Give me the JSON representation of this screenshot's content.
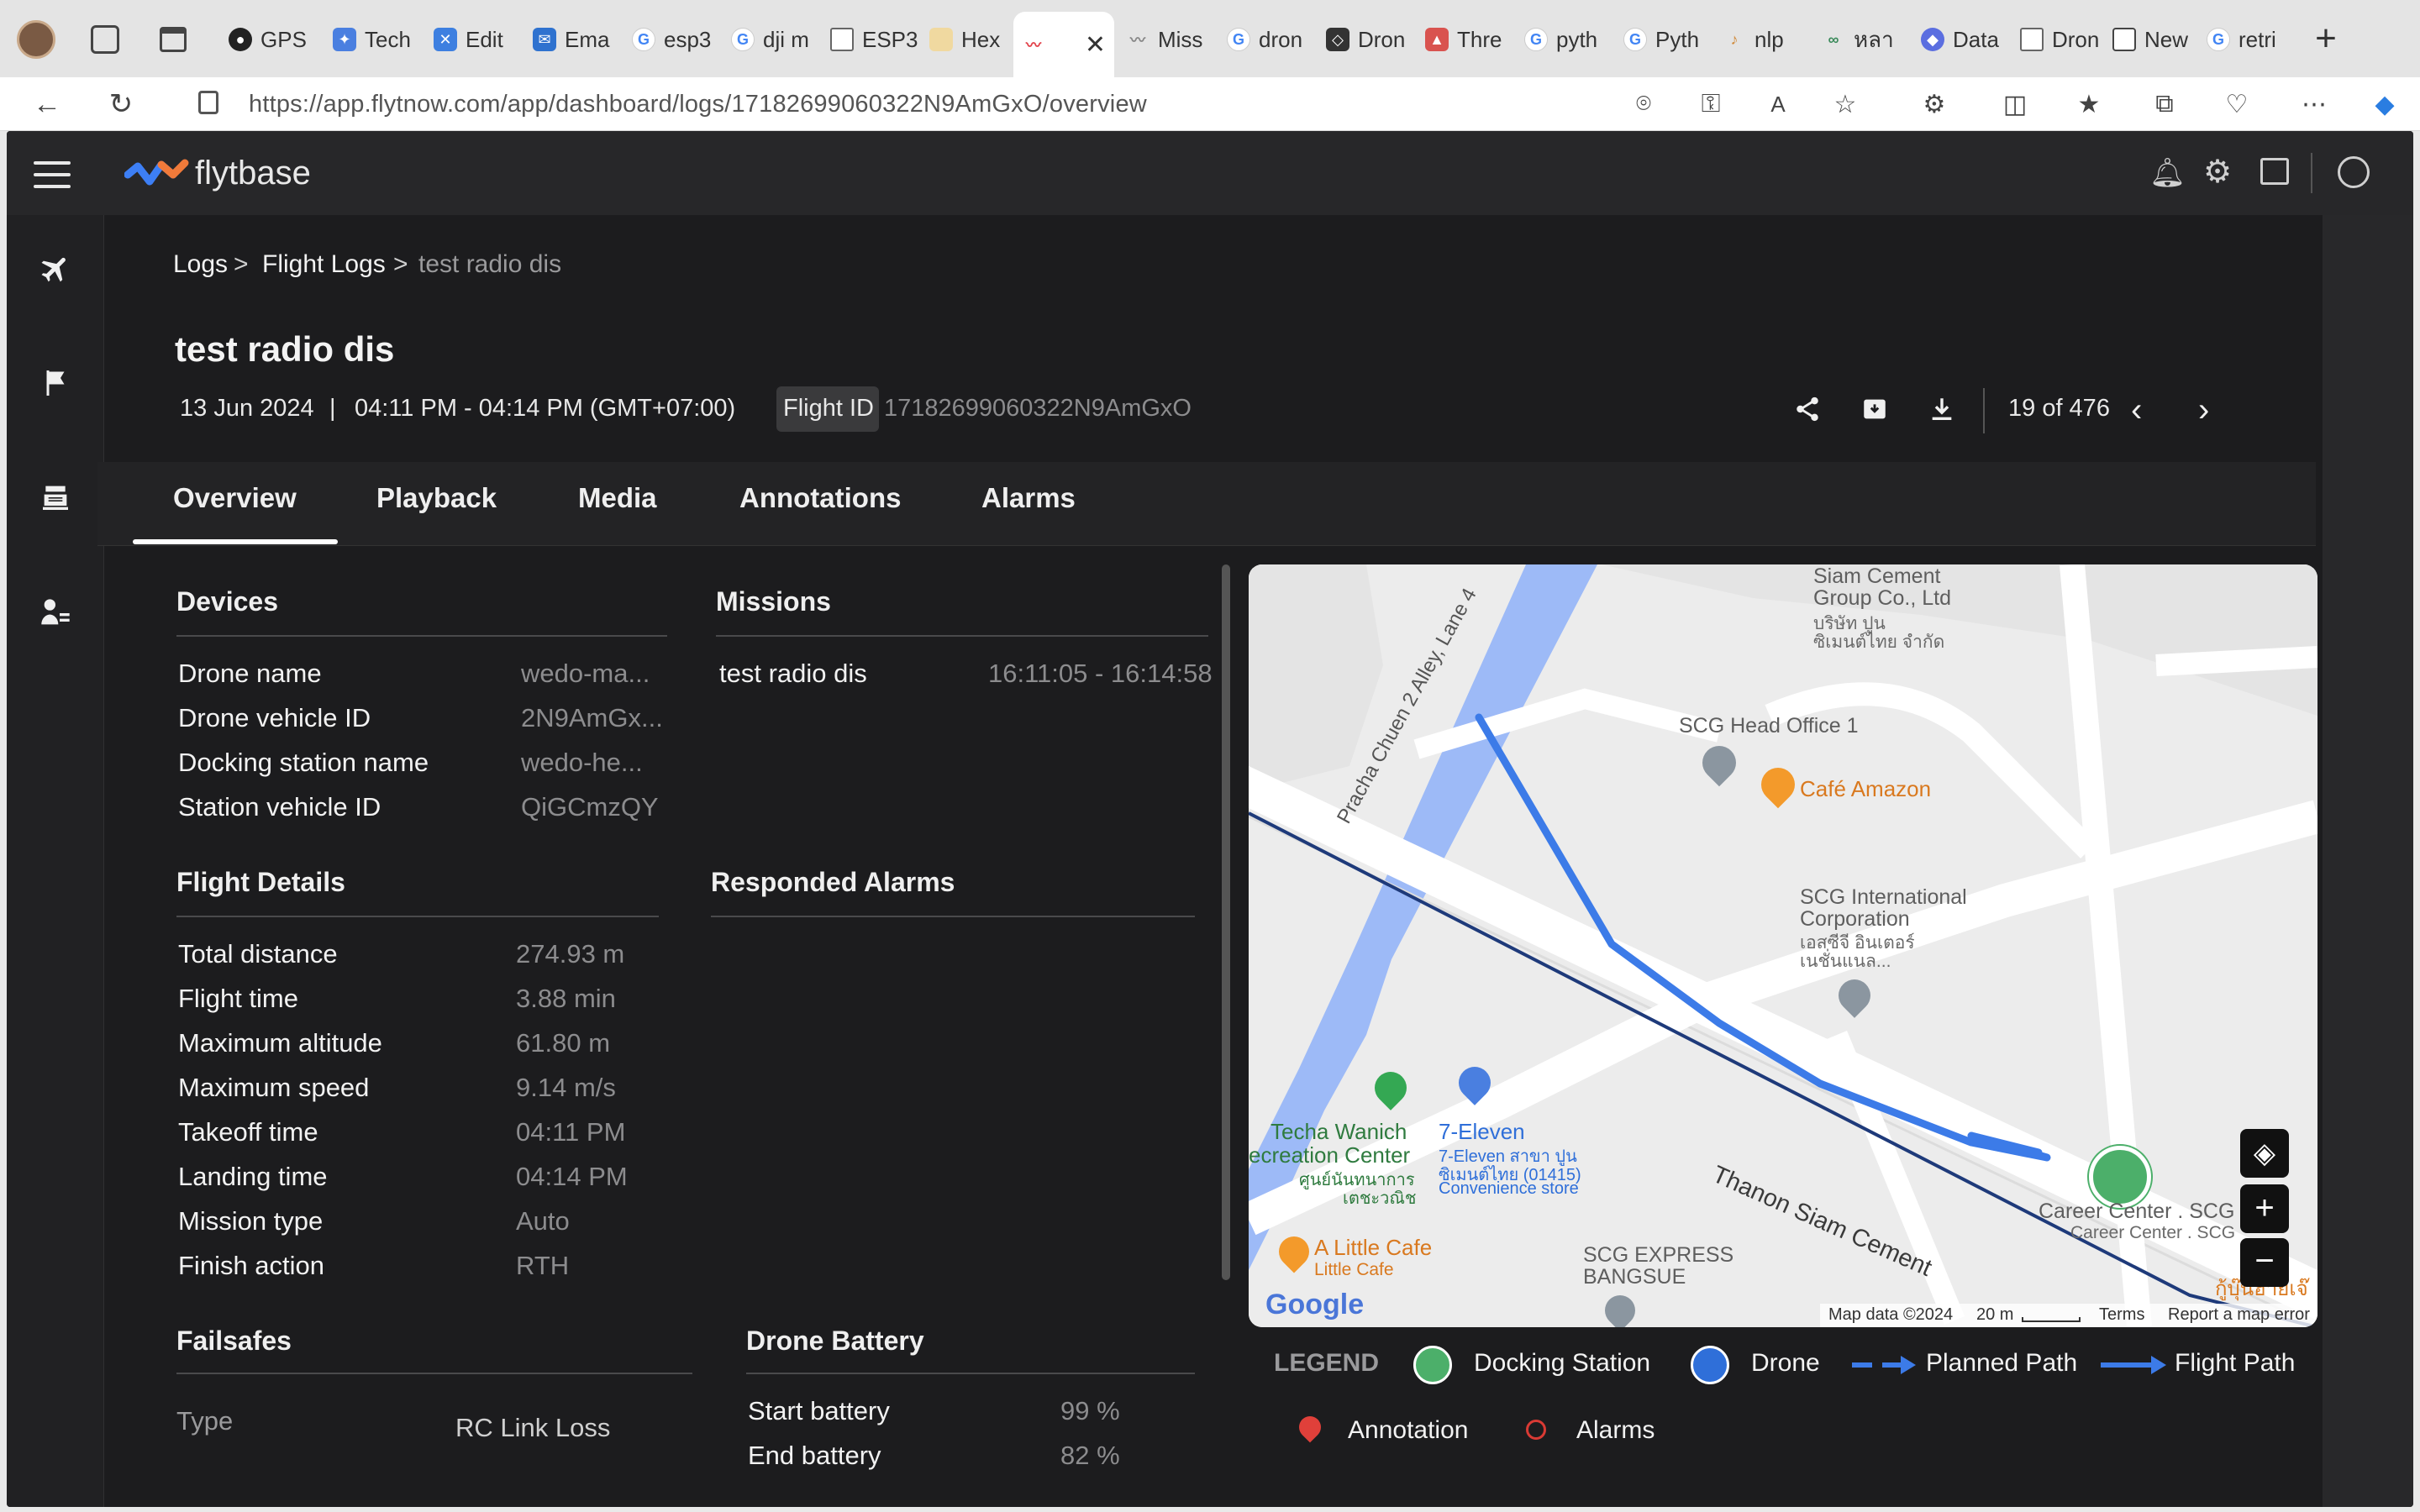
{
  "browser": {
    "tabs": [
      "GPS",
      "Tech",
      "Edit",
      "Ema",
      "esp3",
      "dji m",
      "ESP3",
      "Hex",
      "",
      "Miss",
      "dron",
      "Dron",
      "Thre",
      "pyth",
      "Pyth",
      "nlp",
      "หลา",
      "Data",
      "Dron",
      "New",
      "retri"
    ],
    "url": "https://app.flytnow.com/app/dashboard/logs/17182699060322N9AmGxO/overview",
    "notification_count": "1"
  },
  "app": {
    "brand": "flytbase"
  },
  "breadcrumb": {
    "items": [
      "Logs",
      "Flight Logs",
      "test radio dis"
    ]
  },
  "flight": {
    "title": "test radio dis",
    "date": "13 Jun 2024",
    "separator": "|",
    "time_range": "04:11 PM - 04:14 PM (GMT+07:00)",
    "flight_id_label": "Flight ID",
    "flight_id": "17182699060322N9AmGxO",
    "pager": "19 of 476"
  },
  "tabs": [
    "Overview",
    "Playback",
    "Media",
    "Annotations",
    "Alarms"
  ],
  "devices": {
    "title": "Devices",
    "rows": [
      {
        "label": "Drone name",
        "value": "wedo-ma..."
      },
      {
        "label": "Drone vehicle ID",
        "value": "2N9AmGx..."
      },
      {
        "label": "Docking station name",
        "value": "wedo-he..."
      },
      {
        "label": "Station vehicle ID",
        "value": "QiGCmzQY"
      }
    ]
  },
  "missions": {
    "title": "Missions",
    "name": "test radio dis",
    "time": "16:11:05 - 16:14:58"
  },
  "flight_details": {
    "title": "Flight Details",
    "rows": [
      {
        "label": "Total distance",
        "value": "274.93 m"
      },
      {
        "label": "Flight time",
        "value": "3.88 min"
      },
      {
        "label": "Maximum altitude",
        "value": "61.80 m"
      },
      {
        "label": "Maximum speed",
        "value": "9.14 m/s"
      },
      {
        "label": "Takeoff time",
        "value": "04:11 PM"
      },
      {
        "label": "Landing time",
        "value": "04:14 PM"
      },
      {
        "label": "Mission type",
        "value": "Auto"
      },
      {
        "label": "Finish action",
        "value": "RTH"
      }
    ]
  },
  "responded_alarms": {
    "title": "Responded Alarms"
  },
  "failsafes": {
    "title": "Failsafes",
    "type_label": "Type",
    "type_value": "RC Link Loss"
  },
  "battery": {
    "title": "Drone Battery",
    "rows": [
      {
        "label": "Start battery",
        "value": "99 %"
      },
      {
        "label": "End battery",
        "value": "82 %"
      }
    ]
  },
  "map": {
    "labels": {
      "siam_cement_1": "Siam Cement",
      "siam_cement_2": "Group Co., Ltd",
      "siam_cement_th1": "บริษัท ปูน",
      "siam_cement_th2": "ซิเมนต์ไทย จำกัด",
      "road_pracha": "Pracha Chuen 2 Alley, Lane 4",
      "scg_head": "SCG Head Office 1",
      "cafe_amazon": "Café Amazon",
      "scg_intl_1": "SCG International",
      "scg_intl_2": "Corporation",
      "scg_intl_th1": "เอสซีจี อินเตอร์",
      "scg_intl_th2": "เนชั่นแนล...",
      "techa_1": "Techa Wanich",
      "techa_2": "ecreation Center",
      "techa_th1": "ศูนย์นันทนาการ",
      "techa_th2": "เตชะวณิช",
      "seven_1": "7-Eleven",
      "seven_2": "7-Eleven สาขา ปูน",
      "seven_3": "ซิเมนต์ไทย (01415)",
      "seven_4": "Convenience store",
      "road_siam": "Thanon Siam Cement",
      "career_1": "Career Center . SCG",
      "career_2": "Career Center . SCG",
      "little_cafe_1": "A Little Cafe",
      "little_cafe_2": "Little Cafe",
      "scg_express_1": "SCG EXPRESS",
      "scg_express_2": "BANGSUE",
      "thai_corner": "กู้บุ๊นฮ่ายเจ๊",
      "google": "Google",
      "map_data": "Map data ©2024",
      "scale": "20 m",
      "terms": "Terms",
      "report": "Report a map error"
    }
  },
  "legend": {
    "title": "LEGEND",
    "items": [
      "Docking Station",
      "Drone",
      "Planned Path",
      "Flight Path",
      "Annotation",
      "Alarms"
    ]
  }
}
